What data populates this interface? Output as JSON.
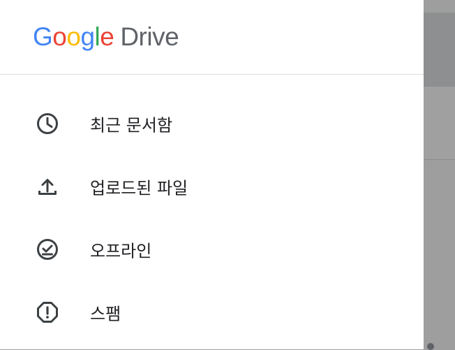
{
  "app": {
    "logo_google": [
      "G",
      "o",
      "o",
      "g",
      "l",
      "e"
    ],
    "logo_drive": "Drive"
  },
  "colors": {
    "google_blue": "#4285F4",
    "google_red": "#EA4335",
    "google_yellow": "#FBBC05",
    "google_green": "#34A853",
    "icon_gray": "#3c4043",
    "text": "#202124",
    "scrim": "#9e9e9e"
  },
  "drawer": {
    "items": [
      {
        "label": "최근 문서함",
        "icon": "clock-icon"
      },
      {
        "label": "업로드된 파일",
        "icon": "upload-icon"
      },
      {
        "label": "오프라인",
        "icon": "offline-check-icon"
      },
      {
        "label": "스팸",
        "icon": "spam-alert-icon"
      }
    ]
  }
}
